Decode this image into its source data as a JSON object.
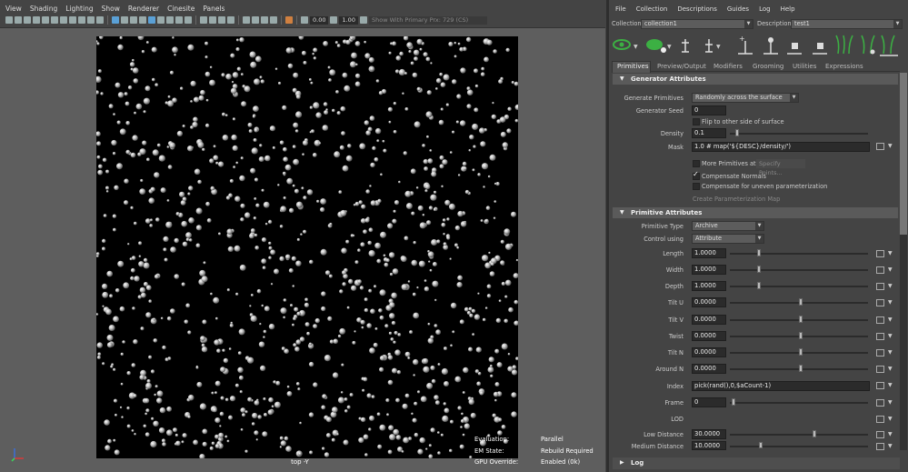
{
  "viewport": {
    "menu": [
      "View",
      "Shading",
      "Lighting",
      "Show",
      "Renderer",
      "Cinesite",
      "Panels"
    ],
    "toolbar": {
      "field1": "0.00",
      "field2": "1.00",
      "display_dropdown": "Show With Primary Prx: 729 (CS)"
    },
    "camera_label": "top -Y",
    "hud": {
      "evaluation_label": "Evaluation:",
      "evaluation_value": "Parallel",
      "em_label": "EM State:",
      "em_value": "Rebuild Required",
      "gpu_label": "GPU Override:",
      "gpu_value": "Enabled (0k)"
    }
  },
  "xgen": {
    "menu": [
      "File",
      "Collection",
      "Descriptions",
      "Guides",
      "Log",
      "Help"
    ],
    "collection_label": "Collection",
    "collection_value": "collection1",
    "description_label": "Description",
    "description_value": "test1",
    "tabs": [
      "Primitives",
      "Preview/Output",
      "Modifiers",
      "Grooming",
      "Utilities",
      "Expressions"
    ],
    "active_tab": "Primitives",
    "generator": {
      "title": "Generator Attributes",
      "generate_label": "Generate Primitives",
      "generate_value": "Randomly across the surface",
      "seed_label": "Generator Seed",
      "seed_value": "0",
      "flip_label": "Flip to other side of surface",
      "density_label": "Density",
      "density_value": "0.1",
      "density_level": 0.03,
      "mask_label": "Mask",
      "mask_value": "1.0 # map('${DESC}/density/')",
      "more_label": "More Primitives at",
      "specify_label": "Specify Points...",
      "comp_normals_label": "Compensate Normals",
      "comp_uneven_label": "Compensate for uneven parameterization",
      "create_param_label": "Create Parameterization Map"
    },
    "primitive": {
      "title": "Primitive Attributes",
      "type_label": "Primitive Type",
      "type_value": "Archive",
      "control_label": "Control using",
      "control_value": "Attribute",
      "rows": [
        {
          "label": "Length",
          "value": "1.0000",
          "level": 0.25
        },
        {
          "label": "Width",
          "value": "1.0000",
          "level": 0.25
        },
        {
          "label": "Depth",
          "value": "1.0000",
          "level": 0.25
        },
        {
          "label": "Tilt U",
          "value": "0.0000",
          "level": 0.5
        },
        {
          "label": "Tilt V",
          "value": "0.0000",
          "level": 0.5
        },
        {
          "label": "Twist",
          "value": "0.0000",
          "level": 0.5
        },
        {
          "label": "Tilt N",
          "value": "0.0000",
          "level": 0.5
        },
        {
          "label": "Around N",
          "value": "0.0000",
          "level": 0.5
        }
      ],
      "index_label": "Index",
      "index_value": "pick(rand(),0,$aCount-1)",
      "frame_label": "Frame",
      "frame_value": "0",
      "frame_level": 0.0,
      "lod_label": "LOD",
      "low_label": "Low Distance",
      "low_value": "30.0000",
      "low_level": 0.6,
      "medium_label": "Medium Distance",
      "medium_value": "10.0000",
      "medium_level": 0.2
    },
    "log_title": "Log"
  }
}
